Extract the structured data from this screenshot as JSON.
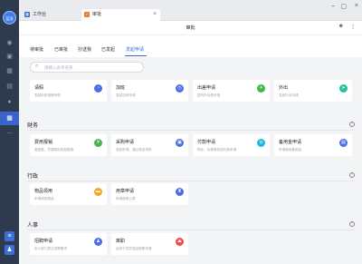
{
  "rail": {
    "avatar_label": "蓝凌",
    "icons": [
      "chat-icon",
      "video-icon",
      "calendar-icon",
      "document-icon",
      "contacts-icon",
      "workbench-icon",
      "more-icon"
    ],
    "bottom_icons": [
      "expand-icon",
      "profile-icon"
    ]
  },
  "tabs": [
    {
      "label": "工作台",
      "icon": "workbench-icon",
      "color": "#3a6cd9"
    },
    {
      "label": "审批",
      "icon": "approval-icon",
      "color": "#f07b2a"
    }
  ],
  "header": {
    "title": "审批"
  },
  "subtabs": [
    "待审批",
    "已审批",
    "抄送我",
    "已发起",
    "发起申请"
  ],
  "active_subtab": "发起申请",
  "search": {
    "placeholder": "请输入表单名称"
  },
  "top_cards": [
    {
      "title": "请假",
      "desc": "发起你的请假申请",
      "color": "#4c6ee5"
    },
    {
      "title": "加班",
      "desc": "发起加班申请",
      "color": "#4c6ee5"
    },
    {
      "title": "出差申请",
      "desc": "国内外出差申请",
      "color": "#3fb84a"
    },
    {
      "title": "外出",
      "desc": "发起外出申请",
      "color": "#25c29b"
    }
  ],
  "sections": [
    {
      "title": "财务",
      "cards": [
        {
          "title": "费用报销",
          "desc": "差旅费、员建费用发起报销",
          "color": "#4caf50"
        },
        {
          "title": "采购申请",
          "desc": "发起申请，通过商品采购",
          "color": "#4c6ee5"
        },
        {
          "title": "付款申请",
          "desc": "物业、水费等发起付款申请",
          "color": "#22b8e0"
        },
        {
          "title": "备用金申请",
          "desc": "申请使用备用金",
          "color": "#4c6ee5"
        }
      ]
    },
    {
      "title": "行政",
      "cards": [
        {
          "title": "物品领用",
          "desc": "申请领用物品",
          "color": "#f5a623"
        },
        {
          "title": "用章申请",
          "desc": "申请使用公章",
          "color": "#4c6ee5"
        }
      ]
    },
    {
      "title": "人事",
      "cards": [
        {
          "title": "招聘申请",
          "desc": "用人部门提交招聘需求",
          "color": "#4c6ee5"
        },
        {
          "title": "离职",
          "desc": "适用于成员发起离职申请",
          "color": "#f04b4b"
        }
      ]
    }
  ]
}
